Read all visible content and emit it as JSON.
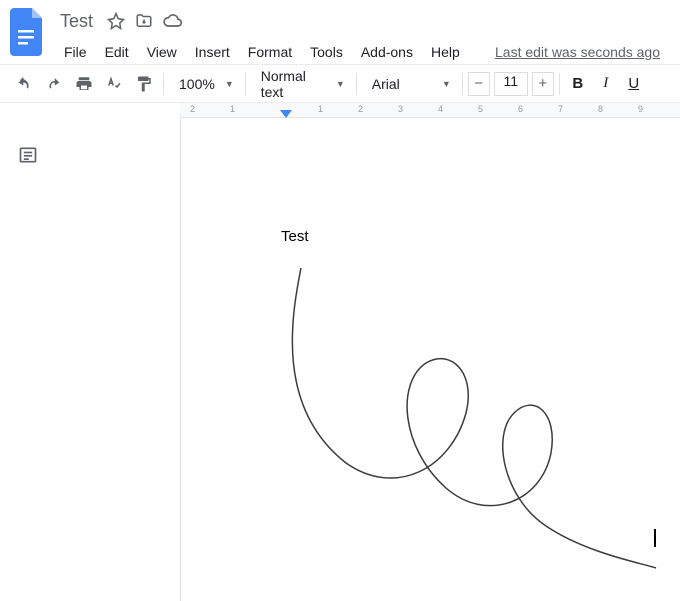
{
  "header": {
    "title": "Test",
    "last_edit": "Last edit was seconds ago"
  },
  "menu": {
    "file": "File",
    "edit": "Edit",
    "view": "View",
    "insert": "Insert",
    "format": "Format",
    "tools": "Tools",
    "addons": "Add-ons",
    "help": "Help"
  },
  "toolbar": {
    "zoom": "100%",
    "style": "Normal text",
    "font": "Arial",
    "font_size": "11",
    "bold": "B",
    "italic": "I",
    "underline": "U"
  },
  "ruler": {
    "marks": [
      "2",
      "1",
      "1",
      "2",
      "3",
      "4",
      "5",
      "6",
      "7",
      "8",
      "9"
    ]
  },
  "document": {
    "body_text": "Test"
  }
}
